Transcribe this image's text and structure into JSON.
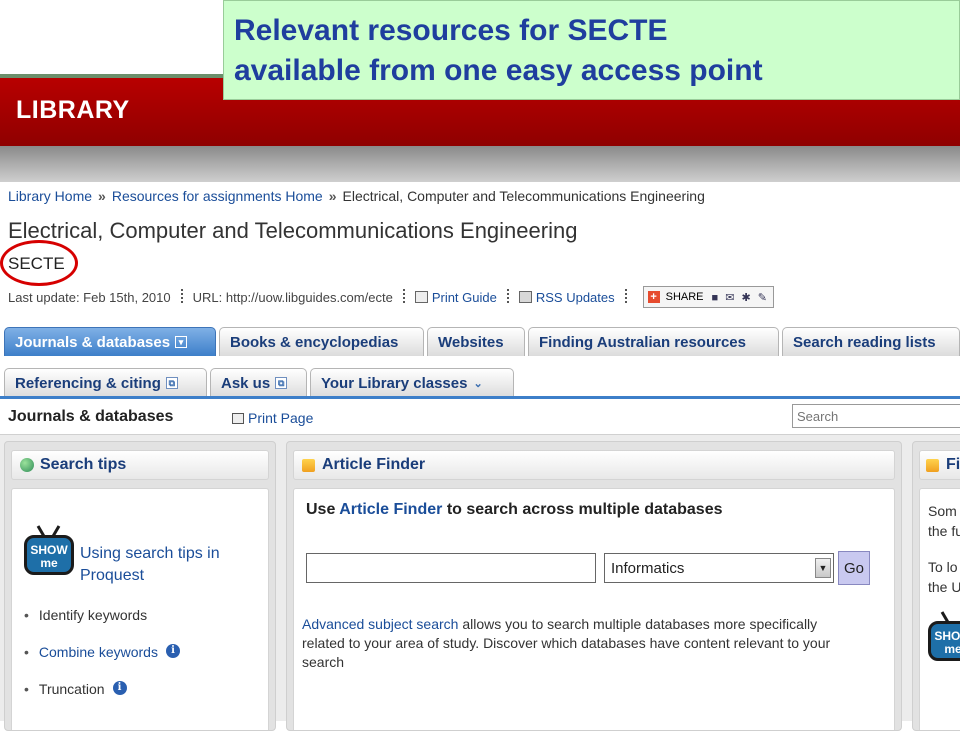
{
  "callout": {
    "line1": "Relevant resources for SECTE",
    "line2": "available from one easy access point"
  },
  "header": {
    "title": "LIBRARY"
  },
  "breadcrumb": {
    "items": [
      "Library Home",
      "Resources for assignments Home",
      "Electrical, Computer and Telecommunications Engineering"
    ],
    "separator": "»"
  },
  "page": {
    "title": "Electrical, Computer and Telecommunications Engineering",
    "subtitle": "SECTE"
  },
  "meta": {
    "last_update": "Last update: Feb 15th, 2010",
    "url": "URL: http://uow.libguides.com/ecte",
    "print_guide": "Print Guide",
    "rss": "RSS Updates",
    "share": "SHARE"
  },
  "tabs_row1": [
    {
      "label": "Journals & databases",
      "active": true
    },
    {
      "label": "Books & encyclopedias"
    },
    {
      "label": "Websites"
    },
    {
      "label": "Finding Australian resources"
    },
    {
      "label": "Search reading lists"
    }
  ],
  "tabs_row2": [
    {
      "label": "Referencing & citing"
    },
    {
      "label": "Ask us"
    },
    {
      "label": "Your Library classes"
    }
  ],
  "section": {
    "title": "Journals & databases",
    "print_page": "Print Page",
    "search_placeholder": "Search"
  },
  "search_tips": {
    "title": "Search tips",
    "show_me": "SHOW me",
    "link": "Using search tips in Proquest",
    "items": [
      "Identify keywords",
      "Combine keywords",
      "Truncation"
    ]
  },
  "article_finder": {
    "title": "Article Finder",
    "intro_pre": "Use",
    "intro_link": "Article Finder",
    "intro_post": "to search across multiple databases",
    "select_value": "Informatics",
    "go_label": "Go",
    "adv_link": "Advanced subject search",
    "desc": "allows you to search multiple databases more specifically related to your area of study. Discover which databases have content relevant to your search"
  },
  "right_box": {
    "title_fragment": "Fi",
    "lines": [
      "Som",
      "the fu",
      "To lo",
      "the U"
    ],
    "show_me": "SHOW me"
  },
  "colors": {
    "header_red": "#a00000",
    "callout_bg": "#ccffcc",
    "callout_text": "#1f3e9e",
    "link_blue": "#1a4d99",
    "active_tab": "#3d7fc9",
    "circle_red": "#d60000"
  }
}
